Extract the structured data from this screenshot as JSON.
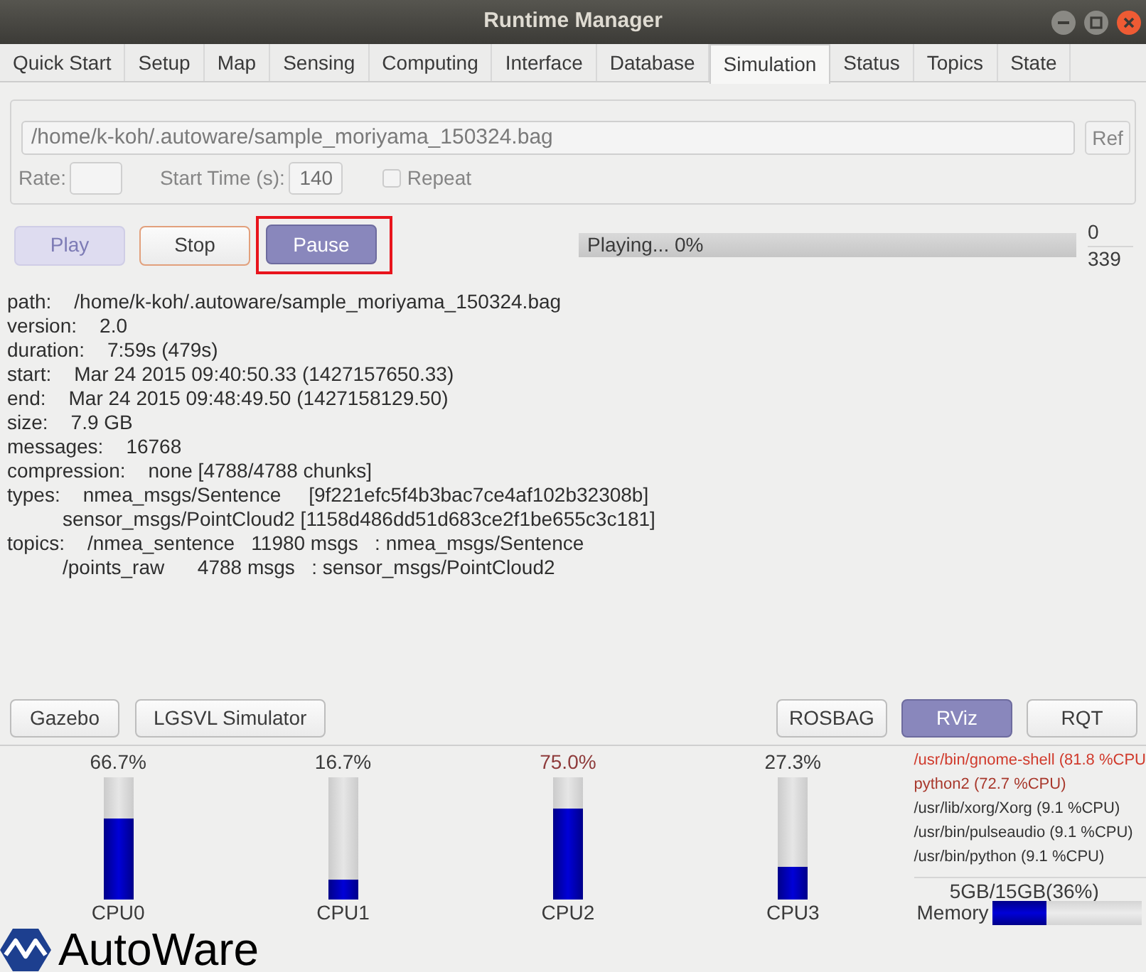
{
  "window": {
    "title": "Runtime Manager"
  },
  "tabs": [
    {
      "label": "Quick Start",
      "selected": false
    },
    {
      "label": "Setup",
      "selected": false
    },
    {
      "label": "Map",
      "selected": false
    },
    {
      "label": "Sensing",
      "selected": false
    },
    {
      "label": "Computing",
      "selected": false
    },
    {
      "label": "Interface",
      "selected": false
    },
    {
      "label": "Database",
      "selected": false
    },
    {
      "label": "Simulation",
      "selected": true
    },
    {
      "label": "Status",
      "selected": false
    },
    {
      "label": "Topics",
      "selected": false
    },
    {
      "label": "State",
      "selected": false
    }
  ],
  "bag_file": {
    "disabled": true,
    "path": "/home/k-koh/.autoware/sample_moriyama_150324.bag",
    "ref_button": "Ref",
    "rate": {
      "label": "Rate:"
    },
    "start_time": {
      "label": "Start Time (s):",
      "value": "140"
    },
    "repeat": {
      "label": "Repeat",
      "checked": false
    }
  },
  "playback": {
    "buttons": [
      {
        "label": "Play",
        "disabled": true,
        "active": true,
        "focused": false,
        "outlined": false
      },
      {
        "label": "Stop",
        "disabled": false,
        "active": false,
        "focused": true,
        "outlined": false
      },
      {
        "label": "Pause",
        "disabled": false,
        "active": true,
        "focused": false,
        "outlined": true
      }
    ],
    "progress": {
      "text": "Playing... 0%",
      "level": 0
    },
    "counter": {
      "current": "0",
      "total": "339"
    }
  },
  "info": [
    {
      "key": "path:",
      "value": "/home/k-koh/.autoware/sample_moriyama_150324.bag"
    },
    {
      "key": "version:",
      "value": "2.0"
    },
    {
      "key": "duration:",
      "value": "7:59s (479s)"
    },
    {
      "key": "start:",
      "value": "Mar 24 2015 09:40:50.33 (1427157650.33)"
    },
    {
      "key": "end:",
      "value": "Mar 24 2015 09:48:49.50 (1427158129.50)"
    },
    {
      "key": "size:",
      "value": "7.9 GB"
    },
    {
      "key": "messages:",
      "value": "16768"
    },
    {
      "key": "compression:",
      "value": "none [4788/4788 chunks]"
    },
    {
      "key": "types:",
      "value": "nmea_msgs/Sentence     [9f221efc5f4b3bac7ce4af102b32308b]"
    },
    {
      "value": "sensor_msgs/PointCloud2 [1158d486dd51d683ce2f1be655c3c181]"
    },
    {
      "key": "topics:",
      "value": "/nmea_sentence   11980 msgs   : nmea_msgs/Sentence"
    },
    {
      "value": "/points_raw      4788 msgs   : sensor_msgs/PointCloud2"
    }
  ],
  "launchers": {
    "left": [
      {
        "label": "Gazebo",
        "active": false
      },
      {
        "label": "LGSVL Simulator",
        "active": false
      }
    ],
    "right": [
      {
        "label": "ROSBAG",
        "active": false
      },
      {
        "label": "RViz",
        "active": true
      },
      {
        "label": "RQT",
        "active": false
      }
    ]
  },
  "cpus": [
    {
      "label": "CPU0",
      "percent": "66.7%",
      "level": 0.667,
      "color": "#3a3a3a"
    },
    {
      "label": "CPU1",
      "percent": "16.7%",
      "level": 0.167,
      "color": "#3a3a3a"
    },
    {
      "label": "CPU2",
      "percent": "75.0%",
      "level": 0.75,
      "color": "#8e3b3b"
    },
    {
      "label": "CPU3",
      "percent": "27.3%",
      "level": 0.273,
      "color": "#3a3a3a"
    }
  ],
  "processes": [
    {
      "text": "/usr/bin/gnome-shell (81.8 %CPU",
      "color": "#d0392b"
    },
    {
      "text": "python2 (72.7 %CPU)",
      "color": "#a8382c"
    },
    {
      "text": "/usr/lib/xorg/Xorg (9.1 %CPU)",
      "color": "#333333"
    },
    {
      "text": "/usr/bin/pulseaudio (9.1 %CPU)",
      "color": "#333333"
    },
    {
      "text": "/usr/bin/python (9.1 %CPU)",
      "color": "#333333"
    }
  ],
  "memory": {
    "usage": "5GB/15GB(36%)",
    "label": "Memory",
    "level": 0.36
  },
  "logo": {
    "text": "AutoWare"
  }
}
